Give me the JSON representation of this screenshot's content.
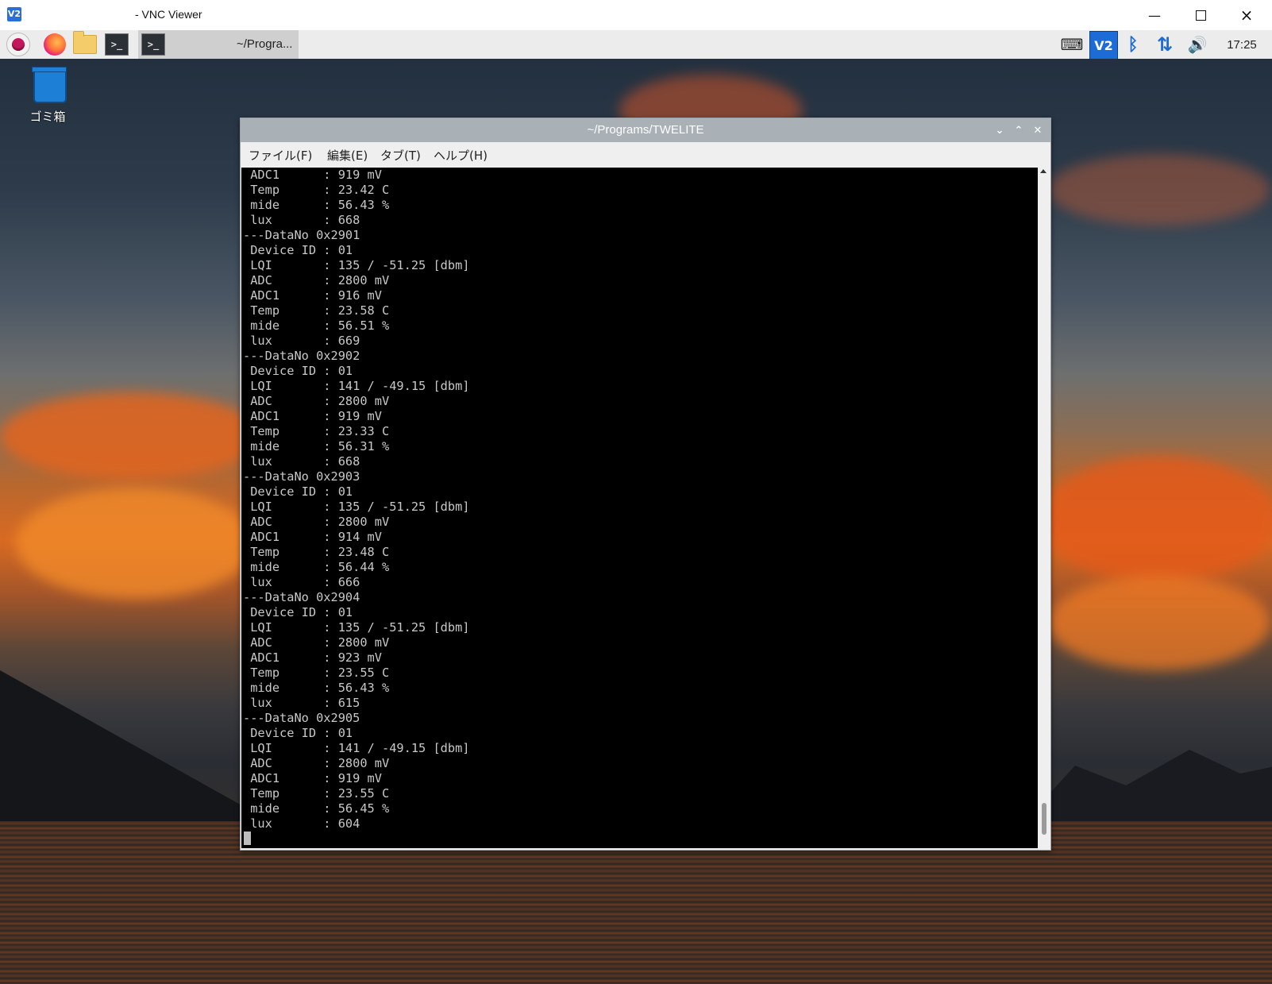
{
  "vnc": {
    "logo": "V2",
    "title": " - VNC Viewer",
    "minimize_icon": "minimize-icon",
    "maximize_icon": "maximize-icon",
    "close_icon": "close-icon"
  },
  "taskbar": {
    "launchers": [
      "raspberry-menu-icon",
      "firefox-icon",
      "file-manager-icon",
      "terminal-icon"
    ],
    "active_task_label": "~/Progra...",
    "tray": {
      "vnc_label": "V2",
      "clock": "17:25"
    }
  },
  "desktop": {
    "trash_label": "ゴミ箱"
  },
  "terminal": {
    "title": "~/Programs/TWELITE",
    "menu": [
      "ファイル(F)",
      "編集(E)",
      "タブ(T)",
      "ヘルプ(H)"
    ],
    "lines": [
      " ADC1      : 919 mV",
      " Temp      : 23.42 C",
      " mide      : 56.43 %",
      " lux       : 668",
      "---DataNo 0x2901",
      " Device ID : 01",
      " LQI       : 135 / -51.25 [dbm]",
      " ADC       : 2800 mV",
      " ADC1      : 916 mV",
      " Temp      : 23.58 C",
      " mide      : 56.51 %",
      " lux       : 669",
      "---DataNo 0x2902",
      " Device ID : 01",
      " LQI       : 141 / -49.15 [dbm]",
      " ADC       : 2800 mV",
      " ADC1      : 919 mV",
      " Temp      : 23.33 C",
      " mide      : 56.31 %",
      " lux       : 668",
      "---DataNo 0x2903",
      " Device ID : 01",
      " LQI       : 135 / -51.25 [dbm]",
      " ADC       : 2800 mV",
      " ADC1      : 914 mV",
      " Temp      : 23.48 C",
      " mide      : 56.44 %",
      " lux       : 666",
      "---DataNo 0x2904",
      " Device ID : 01",
      " LQI       : 135 / -51.25 [dbm]",
      " ADC       : 2800 mV",
      " ADC1      : 923 mV",
      " Temp      : 23.55 C",
      " mide      : 56.43 %",
      " lux       : 615",
      "---DataNo 0x2905",
      " Device ID : 01",
      " LQI       : 141 / -49.15 [dbm]",
      " ADC       : 2800 mV",
      " ADC1      : 919 mV",
      " Temp      : 23.55 C",
      " mide      : 56.45 %",
      " lux       : 604"
    ]
  }
}
